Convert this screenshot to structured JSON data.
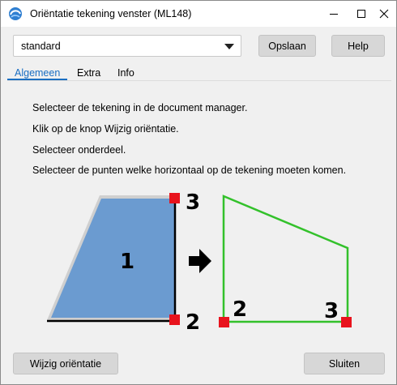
{
  "window": {
    "title": "Oriëntatie tekening venster (ML148)",
    "accent": "#1a6ec2"
  },
  "toolbar": {
    "preset_value": "standard",
    "save_label": "Opslaan",
    "help_label": "Help"
  },
  "tabs": [
    {
      "label": "Algemeen",
      "selected": true
    },
    {
      "label": "Extra",
      "selected": false
    },
    {
      "label": "Info",
      "selected": false
    }
  ],
  "instructions": [
    "Selecteer de tekening in de document manager.",
    "Klik op de knop Wijzig oriëntatie.",
    "Selecteer onderdeel.",
    "Selecteer de punten welke horizontaal op de tekening moeten komen."
  ],
  "diagram": {
    "part_label": "1",
    "point_top_label": "3",
    "point_bottom_label": "2",
    "result_left_label": "2",
    "result_right_label": "3",
    "part_fill": "#6b9bd0",
    "result_stroke": "#33c12b",
    "point_color": "#e8131d",
    "icons": [
      "arrow-right-icon"
    ]
  },
  "footer": {
    "rotate_label": "Wijzig oriëntatie",
    "close_label": "Sluiten"
  }
}
